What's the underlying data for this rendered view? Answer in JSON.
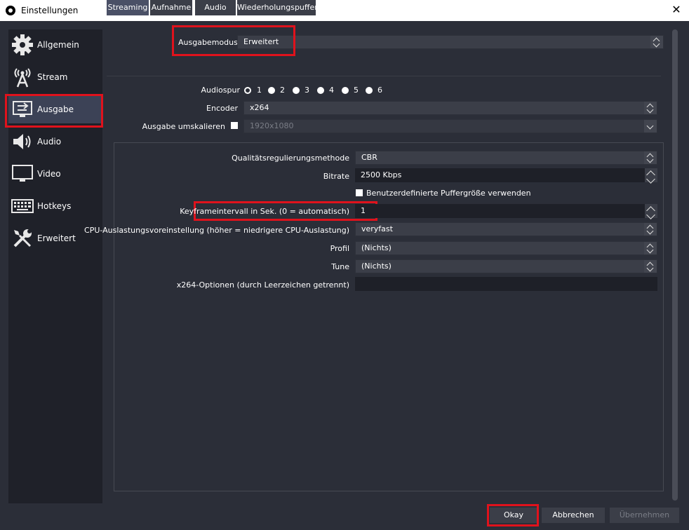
{
  "window": {
    "title": "Einstellungen"
  },
  "sidebar": {
    "items": [
      {
        "label": "Allgemein",
        "icon": "gear-icon"
      },
      {
        "label": "Stream",
        "icon": "antenna-icon"
      },
      {
        "label": "Ausgabe",
        "icon": "output-monitor-icon"
      },
      {
        "label": "Audio",
        "icon": "speaker-icon"
      },
      {
        "label": "Video",
        "icon": "monitor-icon"
      },
      {
        "label": "Hotkeys",
        "icon": "keyboard-icon"
      },
      {
        "label": "Erweitert",
        "icon": "tools-icon"
      }
    ],
    "active_index": 2
  },
  "output_mode": {
    "label": "Ausgabemodus",
    "value": "Erweitert"
  },
  "tabs": [
    "Streaming",
    "Aufnahme",
    "Audio",
    "Wiederholungspuffer"
  ],
  "streaming": {
    "audio_track": {
      "label": "Audiospur",
      "options": [
        "1",
        "2",
        "3",
        "4",
        "5",
        "6"
      ],
      "selected": "1"
    },
    "encoder": {
      "label": "Encoder",
      "value": "x264"
    },
    "rescale": {
      "label": "Ausgabe umskalieren",
      "value": "1920x1080"
    }
  },
  "encoder_settings": {
    "rate_control": {
      "label": "Qualitätsregulierungsmethode",
      "value": "CBR"
    },
    "bitrate": {
      "label": "Bitrate",
      "value": "2500 Kbps"
    },
    "custom_buffer": {
      "label": "Benutzerdefinierte Puffergröße verwenden"
    },
    "keyframe": {
      "label": "Keyframeintervall in Sek. (0 = automatisch)",
      "value": "1"
    },
    "cpu_preset": {
      "label": "CPU-Auslastungsvoreinstellung (höher = niedrigere CPU-Auslastung)",
      "value": "veryfast"
    },
    "profile": {
      "label": "Profil",
      "value": "(Nichts)"
    },
    "tune": {
      "label": "Tune",
      "value": "(Nichts)"
    },
    "x264_options": {
      "label": "x264-Optionen (durch Leerzeichen getrennt)",
      "value": ""
    }
  },
  "buttons": {
    "ok": "Okay",
    "cancel": "Abbrechen",
    "apply": "Übernehmen"
  },
  "colors": {
    "highlight": "#e0121c",
    "background": "#2b2e38",
    "sidebar": "#1f2129",
    "active": "#3c4256"
  }
}
